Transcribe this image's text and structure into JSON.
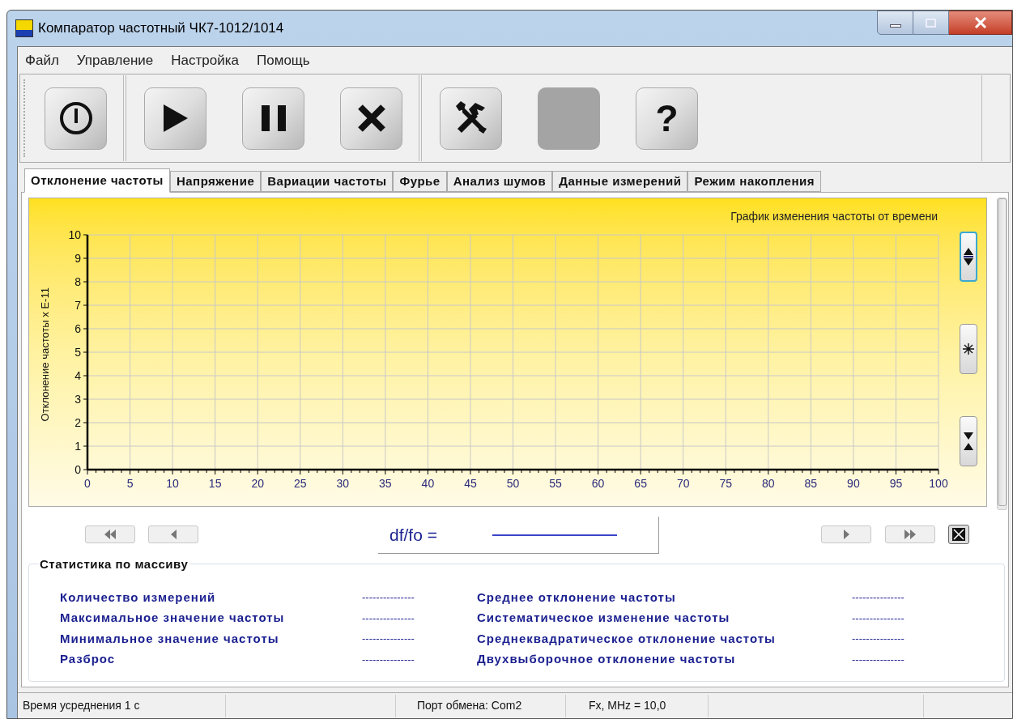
{
  "window": {
    "title": "Компаратор частотный ЧК7-1012/1014"
  },
  "menu": [
    "Файл",
    "Управление",
    "Настройка",
    "Помощь"
  ],
  "toolbar": [
    [
      {
        "kind": "power",
        "disabled": false
      }
    ],
    [
      {
        "kind": "play",
        "disabled": false
      },
      {
        "kind": "pause",
        "disabled": false
      },
      {
        "kind": "stop",
        "disabled": false
      }
    ],
    [
      {
        "kind": "tools",
        "disabled": false
      },
      {
        "kind": "blank",
        "disabled": true
      },
      {
        "kind": "help",
        "disabled": false,
        "label": "?"
      }
    ]
  ],
  "tabs": [
    {
      "label": "Отклонение частоты",
      "selected": true
    },
    {
      "label": "Напряжение",
      "selected": false
    },
    {
      "label": "Вариации частоты",
      "selected": false
    },
    {
      "label": "Фурье",
      "selected": false
    },
    {
      "label": "Анализ шумов",
      "selected": false
    },
    {
      "label": "Данные измерений",
      "selected": false
    },
    {
      "label": "Режим накопления",
      "selected": false
    }
  ],
  "chart": {
    "chart_data": {
      "type": "line",
      "grid": true,
      "title": "График изменения частоты от времени",
      "ylabel": "Отклонение частоты x E-11",
      "xlim": [
        0,
        100
      ],
      "ylim": [
        0,
        10
      ],
      "xticks": [
        0,
        5,
        10,
        15,
        20,
        25,
        30,
        35,
        40,
        45,
        50,
        55,
        60,
        65,
        70,
        75,
        80,
        85,
        90,
        95,
        100
      ],
      "yticks": [
        0,
        1,
        2,
        3,
        4,
        5,
        6,
        7,
        8,
        9,
        10
      ]
    },
    "side_buttons": [
      {
        "kind": "zoom",
        "focused": true
      },
      {
        "kind": "asterisk",
        "focused": false
      },
      {
        "kind": "fit",
        "focused": false
      }
    ]
  },
  "navigation": [
    {
      "kind": "first",
      "disabled": true
    },
    {
      "kind": "prev",
      "disabled": true
    },
    {
      "kind": "next",
      "disabled": true
    },
    {
      "kind": "last",
      "disabled": true
    }
  ],
  "readout": {
    "label": "df/fo ="
  },
  "statistics": {
    "title": "Статистика по массиву",
    "left": [
      {
        "label": "Количество измерений",
        "value": "---------------"
      },
      {
        "label": "Максимальное значение частоты",
        "value": "---------------"
      },
      {
        "label": "Минимальное значение частоты",
        "value": "---------------"
      },
      {
        "label": "Разброс",
        "value": "---------------"
      }
    ],
    "right": [
      {
        "label": "Среднее отклонение частоты",
        "value": "---------------"
      },
      {
        "label": "Систематическое изменение частоты",
        "value": "---------------"
      },
      {
        "label": "Среднеквадратическое отклонение частоты",
        "value": "---------------"
      },
      {
        "label": "Двухвыборочное отклонение частоты",
        "value": "---------------"
      }
    ]
  },
  "status_bar": [
    "Время усреднения 1 с",
    "Порт обмена: Com2",
    "Fx, MHz = 10,0"
  ]
}
